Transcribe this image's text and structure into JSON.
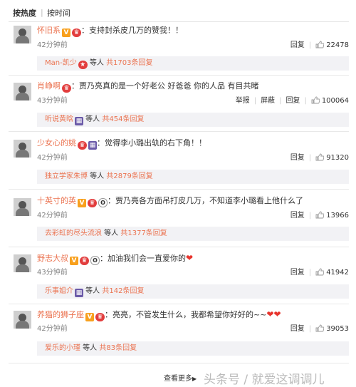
{
  "tabs": {
    "hot": "按热度",
    "time": "按时间",
    "sep": "|"
  },
  "comments": [
    {
      "user": "怀旧系",
      "text": "：支持封杀皮几万的赞我！！",
      "time": "42分钟前",
      "actions": [
        "回复"
      ],
      "likes": "22478",
      "reply": {
        "name": "Man-凯少",
        "mid": " 等人 ",
        "count": "共1703条回复"
      }
    },
    {
      "user": "肖峥啊",
      "text": "：贾乃亮真的是一个好老公 好爸爸 你的人品 有目共睹",
      "time": "43分钟前",
      "actions": [
        "举报",
        "屏蔽",
        "回复"
      ],
      "likes": "100064",
      "reply": {
        "name": "听说黄晗",
        "mid": " 等人 ",
        "count": "共454条回复"
      }
    },
    {
      "user": "少女心的姚",
      "text": "：觉得李小璐出轨的右下角！！",
      "time": "42分钟前",
      "actions": [
        "回复"
      ],
      "likes": "91320",
      "reply": {
        "name": "独立学家朱博",
        "mid": " 等人 ",
        "count": "共2879条回复"
      }
    },
    {
      "user": "十英寸的英",
      "text": "：贾乃亮各方面吊打皮几万，不知道李小璐看上他什么了",
      "time": "42分钟前",
      "actions": [
        "回复"
      ],
      "likes": "13966",
      "reply": {
        "name": "去彩虹的尽头流浪",
        "mid": " 等人 ",
        "count": "共1377条回复"
      }
    },
    {
      "user": "野志大叔",
      "text": "：加油我们会一直爱你的",
      "time": "43分钟前",
      "actions": [
        "回复"
      ],
      "likes": "41942",
      "reply": {
        "name": "乐事姐介",
        "mid": " 等人 ",
        "count": "共142条回复"
      }
    },
    {
      "user": "养猫的狮子座",
      "text": "：亮亮，不管发生什么，我都希望你好好的~~",
      "time": "42分钟前",
      "actions": [
        "回复"
      ],
      "likes": "39053",
      "reply": {
        "name": "爱乐的小瑾",
        "mid": " 等人 ",
        "count": "共83条回复"
      }
    }
  ],
  "footer": {
    "more": "查看更多",
    "arrow": "▶",
    "watermark": "头条号 / 就爱这调调儿"
  },
  "colors": {
    "username": "#eb7350",
    "reply_bg": "#f2f2f5",
    "muted": "#808080"
  }
}
